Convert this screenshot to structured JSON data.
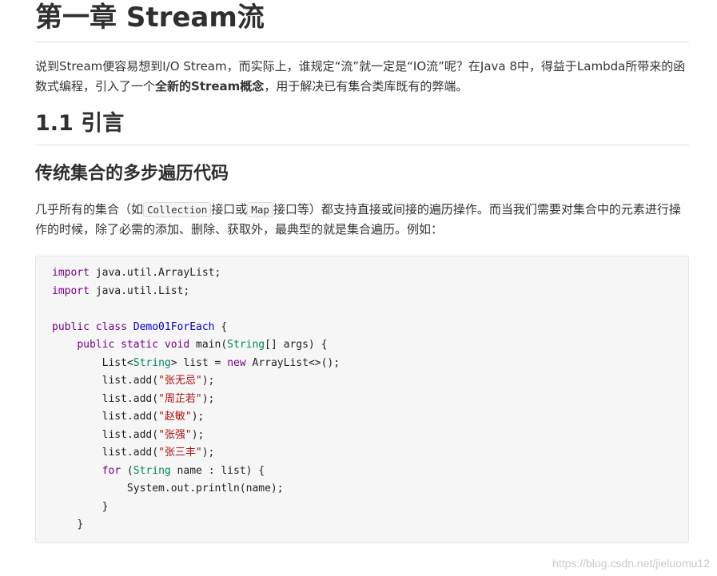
{
  "chapter_title": "第一章 Stream流",
  "intro": {
    "part1": "说到Stream便容易想到I/O Stream，而实际上，谁规定“流”就一定是“IO流”呢？在Java 8中，得益于Lambda所带来的函数式编程，引入了一个",
    "bold": "全新的Stream概念",
    "part2": "，用于解决已有集合类库既有的弊端。"
  },
  "section_title": "1.1 引言",
  "subsection_title": "传统集合的多步遍历代码",
  "paragraph": {
    "part1": "几乎所有的集合（如",
    "code1": "Collection",
    "part2": "接口或",
    "code2": "Map",
    "part3": "接口等）都支持直接或间接的遍历操作。而当我们需要对集合中的元素进行操作的时候，除了必需的添加、删除、获取外，最典型的就是集合遍历。例如："
  },
  "code": {
    "import1_kw": "import",
    "import1_rest": " java.util.ArrayList;",
    "import2_kw": "import",
    "import2_rest": " java.util.List;",
    "class_kw": "public class",
    "class_name": "Demo01ForEach",
    "class_open": " {",
    "method_kw": "public static void",
    "method_name": " main(",
    "method_type": "String",
    "method_rest": "[] args) {",
    "list_decl_a": "List<",
    "list_decl_type": "String",
    "list_decl_b": "> list = ",
    "list_decl_new": "new",
    "list_decl_c": " ArrayList<>();",
    "add_prefix": "list.add(",
    "add_suffix": ");",
    "names": [
      "\"张无忌\"",
      "\"周芷若\"",
      "\"赵敏\"",
      "\"张强\"",
      "\"张三丰\""
    ],
    "for_kw": "for",
    "for_open": " (",
    "for_type": "String",
    "for_rest": " name : list) {",
    "println": "System.out.println(name);",
    "close_inner": "}",
    "close_method": "}"
  },
  "watermark": "https://blog.csdn.net/jieluomu12"
}
